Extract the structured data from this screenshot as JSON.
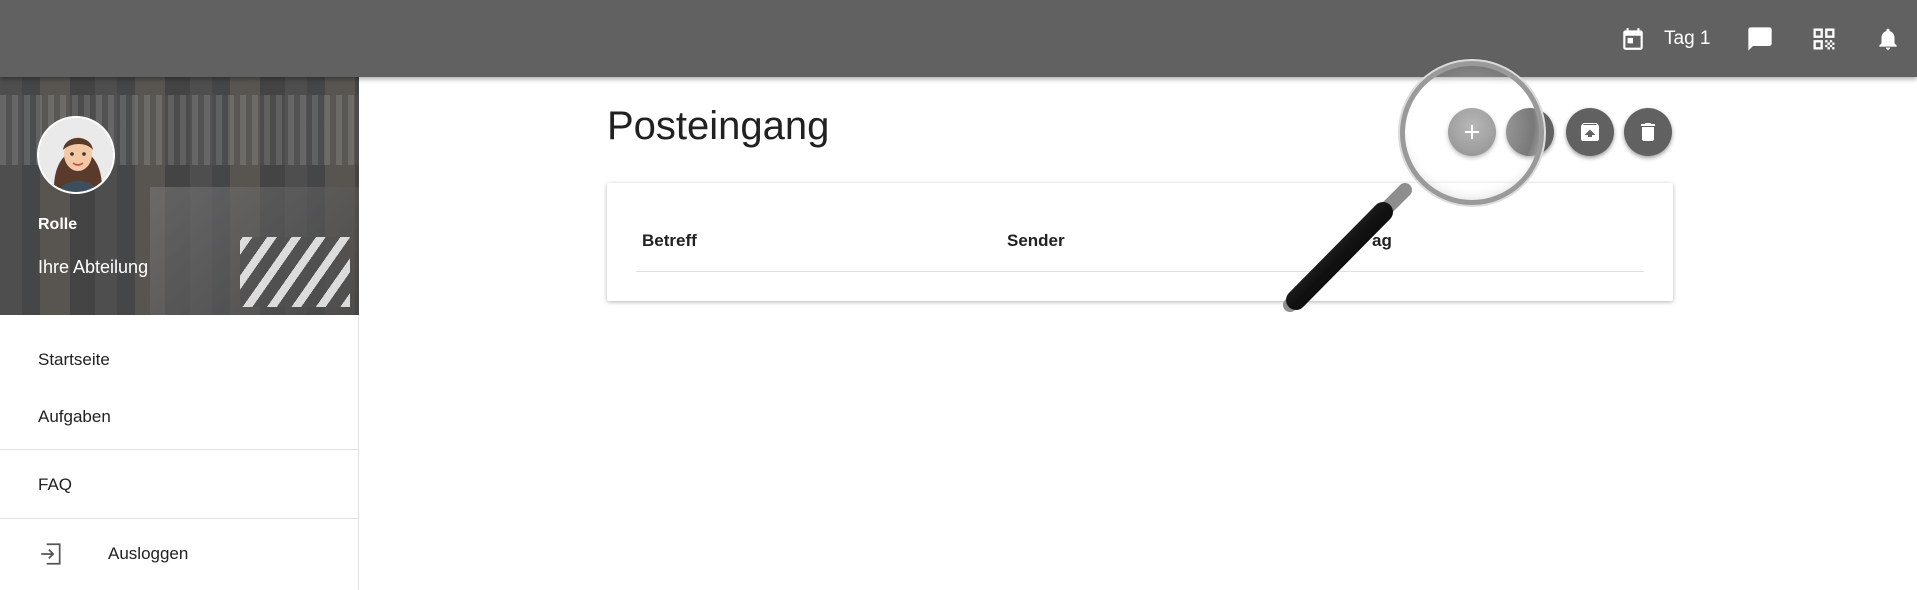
{
  "topbar": {
    "day_label": "Tag 1",
    "icons": [
      "calendar-icon",
      "chat-icon",
      "qr-code-icon",
      "bell-icon"
    ]
  },
  "sidebar": {
    "role": "Rolle",
    "department": "Ihre Abteilung",
    "items": [
      {
        "label": "Startseite"
      },
      {
        "label": "Aufgaben"
      },
      {
        "label": "FAQ"
      },
      {
        "label": "Ausloggen",
        "icon": "logout-icon"
      }
    ]
  },
  "main": {
    "title": "Posteingang",
    "actions": [
      "add-icon",
      "archive-icon",
      "delete-icon"
    ],
    "table": {
      "columns": [
        "Betreff",
        "Sender",
        "ag"
      ]
    }
  },
  "colors": {
    "topbar": "#616161",
    "fab": "#616161",
    "text": "#212121"
  }
}
